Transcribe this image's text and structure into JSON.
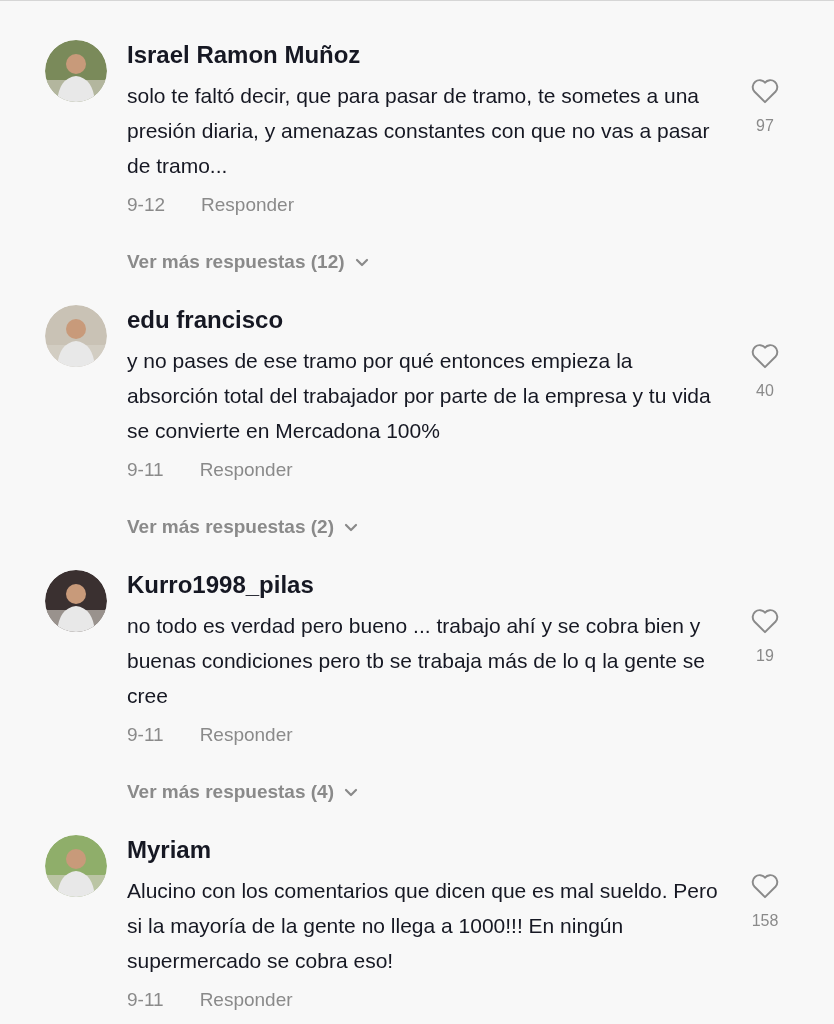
{
  "comments": [
    {
      "author": "Israel Ramon Muñoz",
      "text": "solo te faltó decir, que para pasar de tramo, te sometes a una presión diaria, y amenazas constantes con que no vas a pasar de tramo...",
      "date": "9-12",
      "reply": "Responder",
      "likes": "97",
      "liked": false,
      "more_replies": "Ver más respuestas (12)"
    },
    {
      "author": "edu francisco",
      "text": "y no pases de ese tramo por qué entonces empieza la absorción total del trabajador por parte de la empresa y tu vida se convierte en Mercadona 100%",
      "date": "9-11",
      "reply": "Responder",
      "likes": "40",
      "liked": false,
      "more_replies": "Ver más respuestas (2)"
    },
    {
      "author": "Kurro1998_pilas",
      "text": "no todo es verdad pero bueno ... trabajo ahí y se cobra bien y buenas condiciones pero tb se trabaja más de lo q la gente se cree",
      "date": "9-11",
      "reply": "Responder",
      "likes": "19",
      "liked": false,
      "more_replies": "Ver más respuestas (4)"
    },
    {
      "author": "Myriam",
      "text": "Alucino con los comentarios que dicen que es mal sueldo. Pero si la mayoría de la gente no llega a 1000!!! En ningún supermercado se cobra eso!",
      "date": "9-11",
      "reply": "Responder",
      "likes": "158",
      "liked": false
    }
  ]
}
